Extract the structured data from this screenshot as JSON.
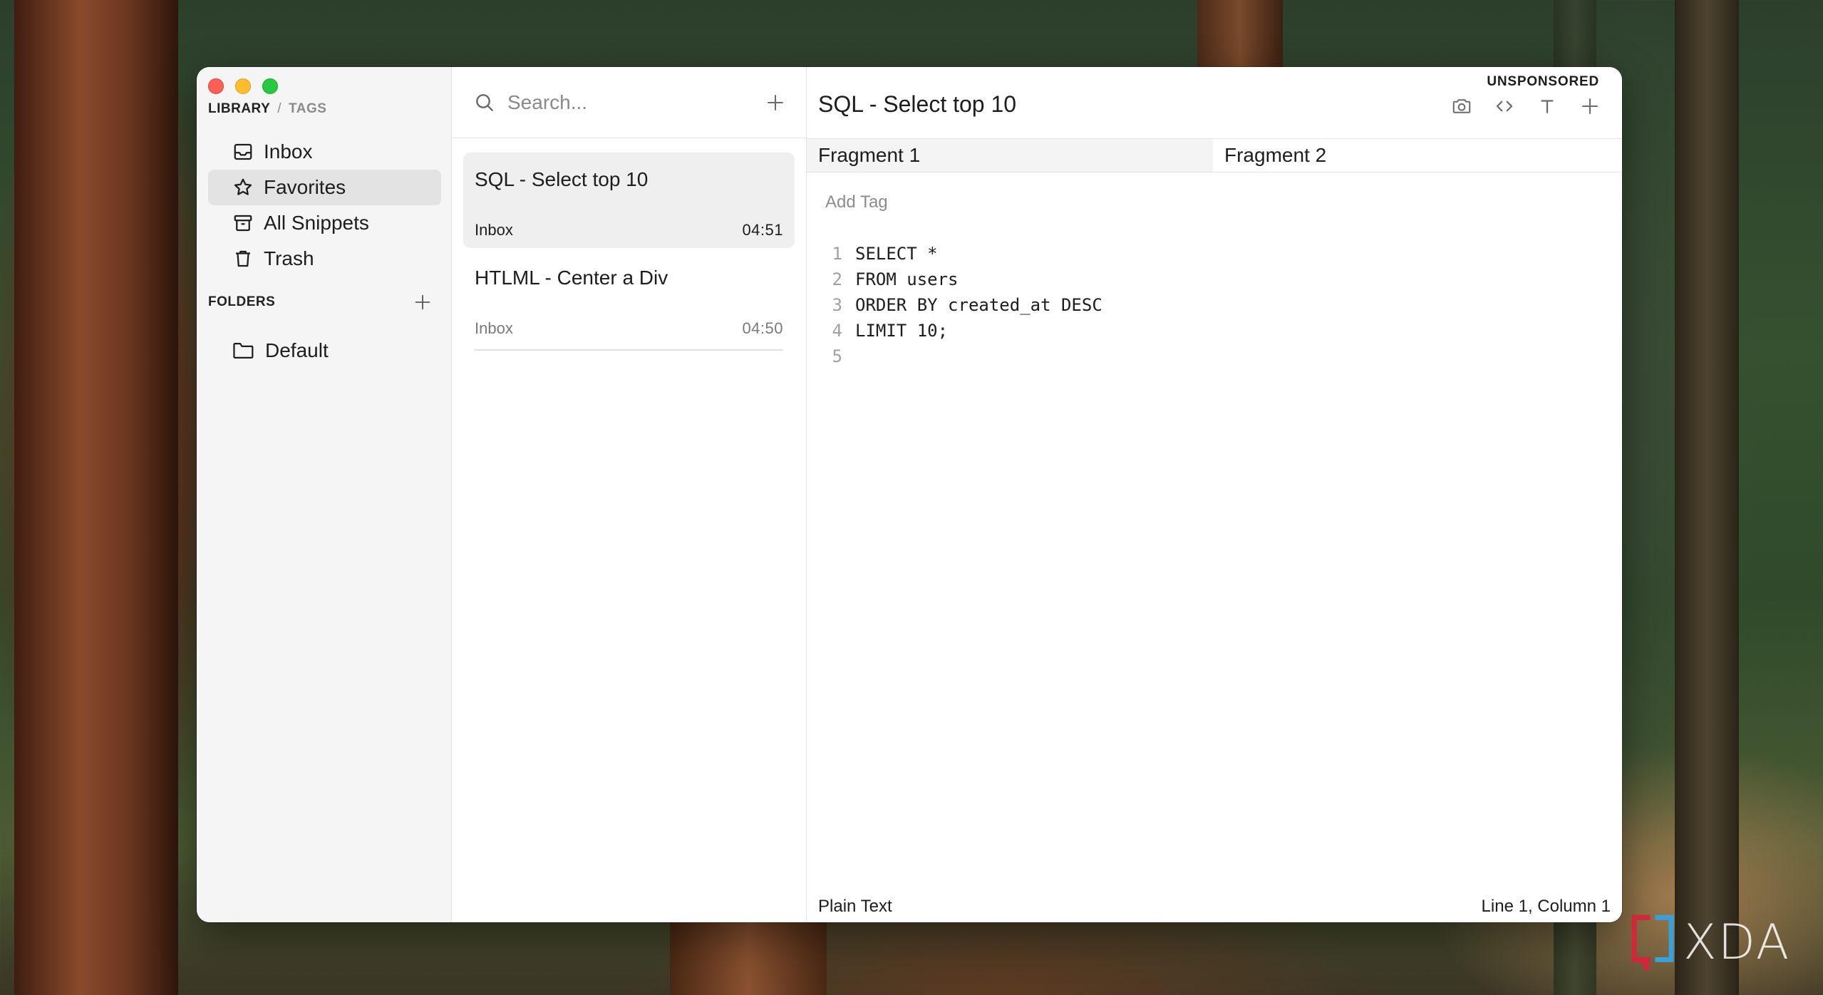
{
  "window": {
    "sidebar": {
      "tabs": {
        "library": "LIBRARY",
        "separator": "/",
        "tags": "TAGS"
      },
      "nav_items": [
        {
          "label": "Inbox",
          "icon": "inbox-icon",
          "selected": false
        },
        {
          "label": "Favorites",
          "icon": "star-icon",
          "selected": true
        },
        {
          "label": "All Snippets",
          "icon": "archive-icon",
          "selected": false
        },
        {
          "label": "Trash",
          "icon": "trash-icon",
          "selected": false
        }
      ],
      "folders_label": "FOLDERS",
      "folders": [
        {
          "label": "Default",
          "icon": "folder-icon"
        }
      ]
    },
    "list": {
      "search": {
        "placeholder": "Search...",
        "value": ""
      },
      "snippets": [
        {
          "title": "SQL - Select top 10",
          "folder": "Inbox",
          "time": "04:51",
          "selected": true
        },
        {
          "title": "HTLML - Center a Div",
          "folder": "Inbox",
          "time": "04:50",
          "selected": false
        }
      ]
    },
    "editor": {
      "badge": "UNSPONSORED",
      "title": "SQL - Select top 10",
      "toolbar": [
        "camera-icon",
        "code-icon",
        "text-format-icon",
        "plus-icon"
      ],
      "fragments": [
        "Fragment 1",
        "Fragment 2"
      ],
      "active_fragment": "Fragment 1",
      "add_tag_label": "Add Tag",
      "code_lines": [
        {
          "num": "1",
          "text": "SELECT *"
        },
        {
          "num": "2",
          "text": "FROM users"
        },
        {
          "num": "3",
          "text": "ORDER BY created_at DESC"
        },
        {
          "num": "4",
          "text": "LIMIT 10;"
        },
        {
          "num": "5",
          "text": ""
        }
      ],
      "status": {
        "language": "Plain Text",
        "position": "Line 1, Column 1"
      }
    }
  },
  "watermark": {
    "text": "XDA"
  },
  "colors": {
    "traffic_red": "#fe5f57",
    "traffic_yellow": "#febc2e",
    "traffic_green": "#28c840",
    "selected_bg": "#e3e3e3",
    "sidebar_bg": "#f5f5f5"
  }
}
